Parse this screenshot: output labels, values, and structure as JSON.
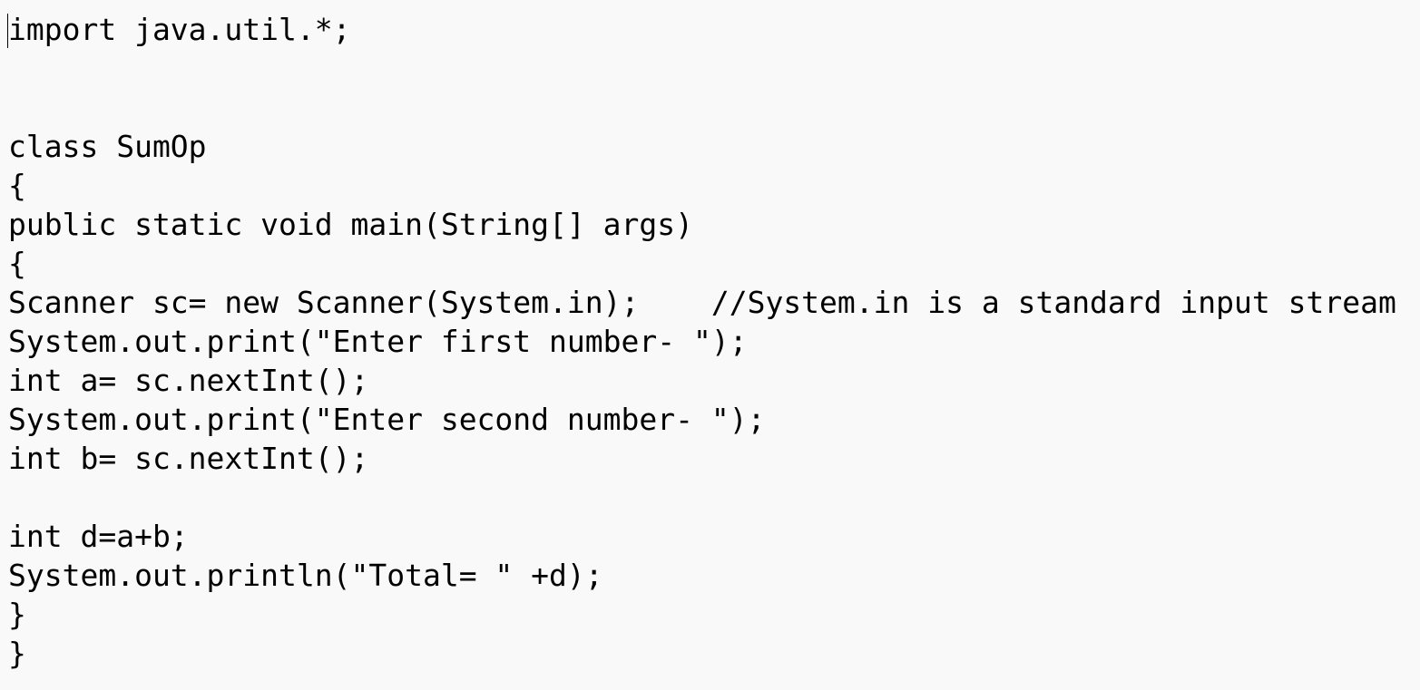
{
  "editor": {
    "lines": [
      "import java.util.*;",
      "",
      "",
      "class SumOp",
      "{",
      "public static void main(String[] args)",
      "{",
      "Scanner sc= new Scanner(System.in);    //System.in is a standard input stream",
      "System.out.print(\"Enter first number- \");",
      "int a= sc.nextInt();",
      "System.out.print(\"Enter second number- \");",
      "int b= sc.nextInt();",
      "",
      "int d=a+b;",
      "System.out.println(\"Total= \" +d);",
      "}",
      "}"
    ]
  }
}
